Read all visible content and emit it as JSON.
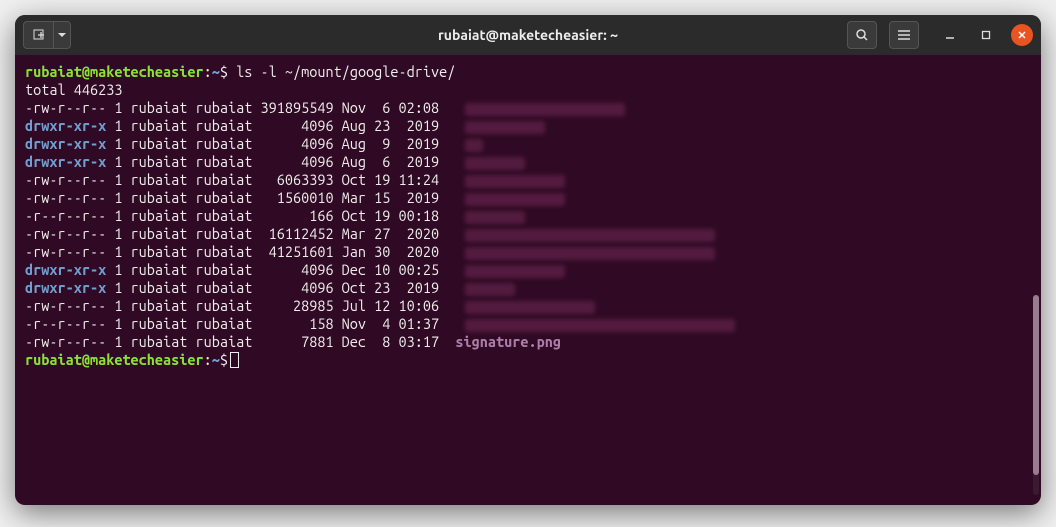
{
  "window": {
    "title": "rubaiat@maketecheasier: ~"
  },
  "prompt": {
    "user_host": "rubaiat@maketecheasier",
    "sep": ":",
    "path": "~",
    "dollar": "$"
  },
  "command": "ls -l ~/mount/google-drive/",
  "total_line": "total 446233",
  "listing": [
    {
      "perm": "-rw-r--r--",
      "links": "1",
      "owner": "rubaiat",
      "group": "rubaiat",
      "size": "391895549",
      "date": "Nov  6 02:08",
      "name": "",
      "type": "file",
      "redacted": true,
      "rw": 160,
      "rh": 13
    },
    {
      "perm": "drwxr-xr-x",
      "links": "1",
      "owner": "rubaiat",
      "group": "rubaiat",
      "size": "4096",
      "date": "Aug 23  2019",
      "name": "",
      "type": "dir",
      "redacted": true,
      "rw": 80,
      "rh": 13
    },
    {
      "perm": "drwxr-xr-x",
      "links": "1",
      "owner": "rubaiat",
      "group": "rubaiat",
      "size": "4096",
      "date": "Aug  9  2019",
      "name": "",
      "type": "dir",
      "redacted": true,
      "rw": 18,
      "rh": 13
    },
    {
      "perm": "drwxr-xr-x",
      "links": "1",
      "owner": "rubaiat",
      "group": "rubaiat",
      "size": "4096",
      "date": "Aug  6  2019",
      "name": "",
      "type": "dir",
      "redacted": true,
      "rw": 60,
      "rh": 13
    },
    {
      "perm": "-rw-r--r--",
      "links": "1",
      "owner": "rubaiat",
      "group": "rubaiat",
      "size": "6063393",
      "date": "Oct 19 11:24",
      "name": "",
      "type": "file",
      "redacted": true,
      "rw": 100,
      "rh": 13
    },
    {
      "perm": "-rw-r--r--",
      "links": "1",
      "owner": "rubaiat",
      "group": "rubaiat",
      "size": "1560010",
      "date": "Mar 15  2019",
      "name": "",
      "type": "file",
      "redacted": true,
      "rw": 100,
      "rh": 13
    },
    {
      "perm": "-r--r--r--",
      "links": "1",
      "owner": "rubaiat",
      "group": "rubaiat",
      "size": "166",
      "date": "Oct 19 00:18",
      "name": "",
      "type": "file",
      "redacted": true,
      "rw": 60,
      "rh": 13
    },
    {
      "perm": "-rw-r--r--",
      "links": "1",
      "owner": "rubaiat",
      "group": "rubaiat",
      "size": "16112452",
      "date": "Mar 27  2020",
      "name": "",
      "type": "file",
      "redacted": true,
      "rw": 250,
      "rh": 13
    },
    {
      "perm": "-rw-r--r--",
      "links": "1",
      "owner": "rubaiat",
      "group": "rubaiat",
      "size": "41251601",
      "date": "Jan 30  2020",
      "name": "",
      "type": "file",
      "redacted": true,
      "rw": 250,
      "rh": 13
    },
    {
      "perm": "drwxr-xr-x",
      "links": "1",
      "owner": "rubaiat",
      "group": "rubaiat",
      "size": "4096",
      "date": "Dec 10 00:25",
      "name": "",
      "type": "dir",
      "redacted": true,
      "rw": 100,
      "rh": 13
    },
    {
      "perm": "drwxr-xr-x",
      "links": "1",
      "owner": "rubaiat",
      "group": "rubaiat",
      "size": "4096",
      "date": "Oct 23  2019",
      "name": "",
      "type": "dir",
      "redacted": true,
      "rw": 50,
      "rh": 13
    },
    {
      "perm": "-rw-r--r--",
      "links": "1",
      "owner": "rubaiat",
      "group": "rubaiat",
      "size": "28985",
      "date": "Jul 12 10:06",
      "name": "",
      "type": "file",
      "redacted": true,
      "rw": 130,
      "rh": 13
    },
    {
      "perm": "-r--r--r--",
      "links": "1",
      "owner": "rubaiat",
      "group": "rubaiat",
      "size": "158",
      "date": "Nov  4 01:37",
      "name": "",
      "type": "file",
      "redacted": true,
      "rw": 270,
      "rh": 13
    },
    {
      "perm": "-rw-r--r--",
      "links": "1",
      "owner": "rubaiat",
      "group": "rubaiat",
      "size": "7881",
      "date": "Dec  8 03:17",
      "name": "signature.png",
      "type": "file",
      "redacted": false
    }
  ]
}
